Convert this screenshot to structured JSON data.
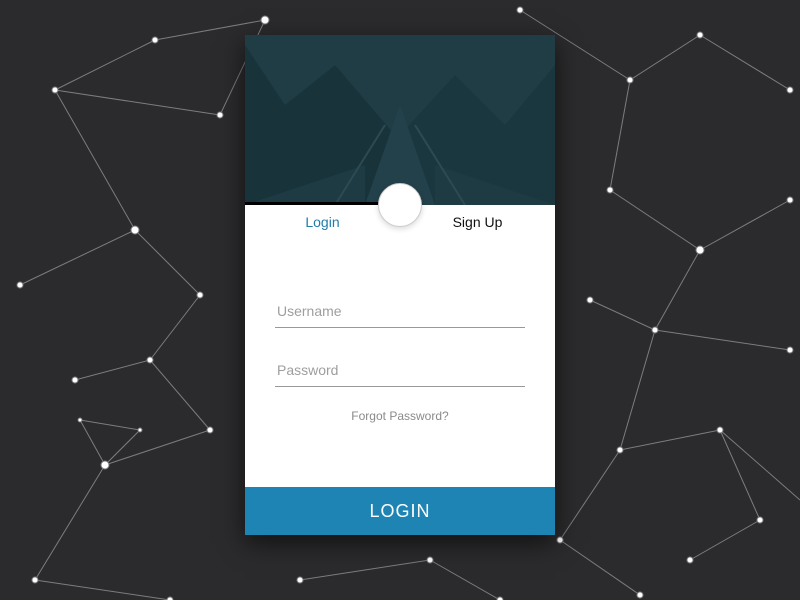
{
  "tabs": {
    "login": "Login",
    "signup": "Sign Up"
  },
  "fields": {
    "username_placeholder": "Username",
    "password_placeholder": "Password"
  },
  "links": {
    "forgot": "Forgot Password?"
  },
  "buttons": {
    "login": "LOGIN"
  }
}
